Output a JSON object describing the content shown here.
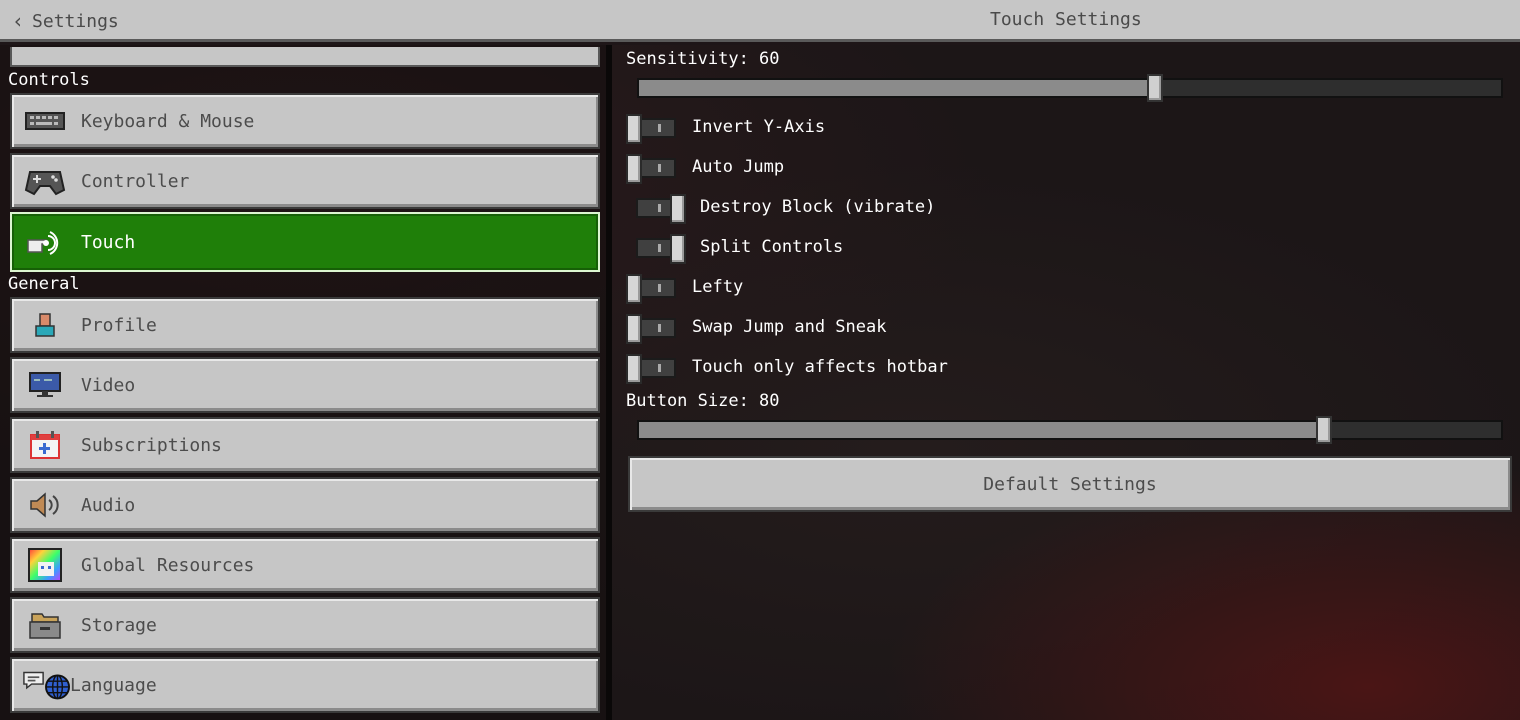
{
  "header": {
    "back_label": "Settings",
    "title": "Touch Settings"
  },
  "sidebar": {
    "sections": [
      {
        "label": "Controls"
      },
      {
        "label": "General"
      }
    ],
    "items": [
      {
        "label": "Keyboard & Mouse",
        "icon": "keyboard-icon"
      },
      {
        "label": "Controller",
        "icon": "gamepad-icon"
      },
      {
        "label": "Touch",
        "icon": "touch-hand-icon",
        "active": true
      },
      {
        "label": "Profile",
        "icon": "profile-icon"
      },
      {
        "label": "Video",
        "icon": "monitor-icon"
      },
      {
        "label": "Subscriptions",
        "icon": "calendar-plus-icon"
      },
      {
        "label": "Audio",
        "icon": "speaker-icon"
      },
      {
        "label": "Global Resources",
        "icon": "rainbow-pack-icon"
      },
      {
        "label": "Storage",
        "icon": "storage-box-icon"
      },
      {
        "label": "Language",
        "icon": "globe-chat-icon"
      }
    ]
  },
  "settings": {
    "sensitivity": {
      "label": "Sensitivity: 60",
      "value": 60,
      "max": 100
    },
    "toggles": [
      {
        "label": "Invert Y-Axis",
        "on": false
      },
      {
        "label": "Auto Jump",
        "on": false
      },
      {
        "label": "Destroy Block (vibrate)",
        "on": true
      },
      {
        "label": "Split Controls",
        "on": true
      },
      {
        "label": "Lefty",
        "on": false
      },
      {
        "label": "Swap Jump and Sneak",
        "on": false
      },
      {
        "label": "Touch only affects hotbar",
        "on": false
      }
    ],
    "button_size": {
      "label": "Button Size: 80",
      "value": 80,
      "max": 100
    },
    "default_button_label": "Default Settings"
  },
  "colors": {
    "active_green": "#1f7f09",
    "button_gray": "#c6c6c6"
  }
}
